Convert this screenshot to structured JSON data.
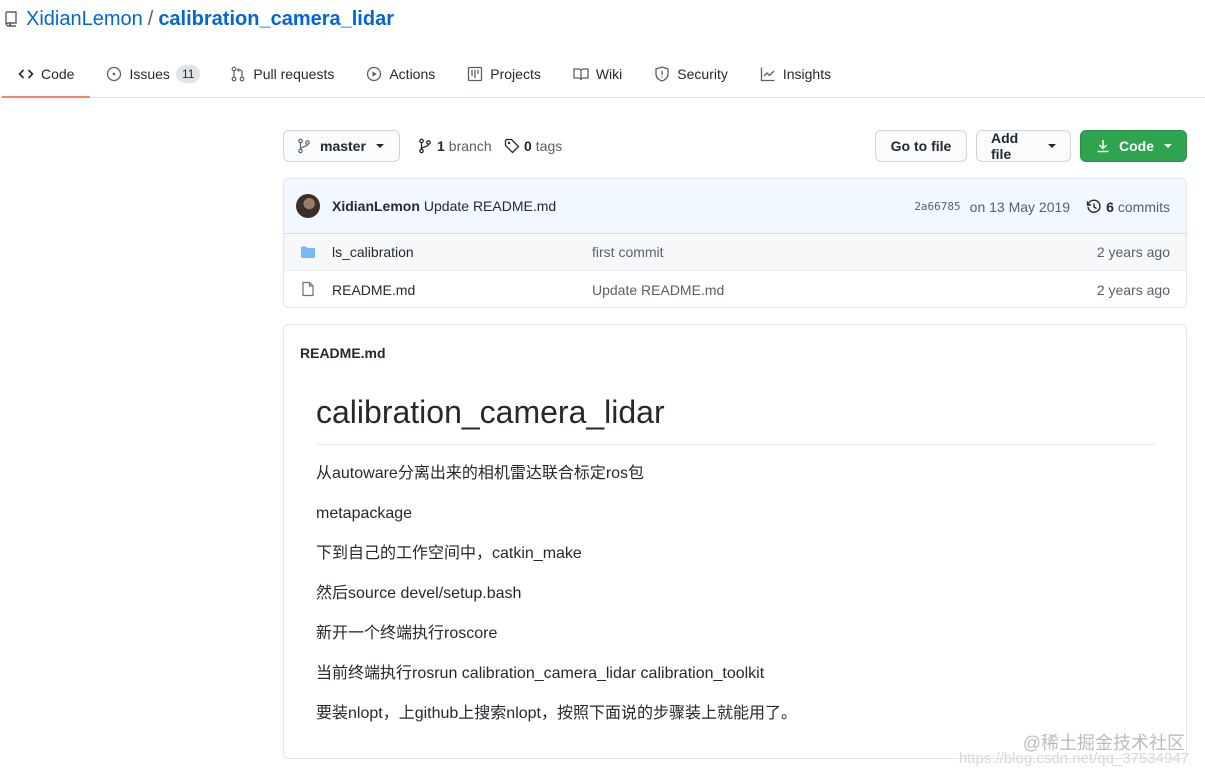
{
  "repo": {
    "owner": "XidianLemon",
    "separator": "/",
    "name": "calibration_camera_lidar"
  },
  "tabs": [
    {
      "label": "Code",
      "icon": "code-icon",
      "active": true
    },
    {
      "label": "Issues",
      "icon": "issue-opened-icon",
      "count": "11"
    },
    {
      "label": "Pull requests",
      "icon": "git-pull-request-icon"
    },
    {
      "label": "Actions",
      "icon": "play-icon"
    },
    {
      "label": "Projects",
      "icon": "project-icon"
    },
    {
      "label": "Wiki",
      "icon": "book-icon"
    },
    {
      "label": "Security",
      "icon": "shield-icon"
    },
    {
      "label": "Insights",
      "icon": "graph-icon"
    }
  ],
  "toolbar": {
    "branch_label": "master",
    "branch_count": "1",
    "branch_word": "branch",
    "tag_count": "0",
    "tag_word": "tags",
    "goto_file_label": "Go to file",
    "add_file_label": "Add file",
    "code_label": "Code"
  },
  "commit": {
    "author": "XidianLemon",
    "message": "Update README.md",
    "sha": "2a66785",
    "date": "on 13 May 2019",
    "commit_count": "6",
    "commit_word": "commits"
  },
  "files": [
    {
      "name": "ls_calibration",
      "type": "folder",
      "commit": "first commit",
      "age": "2 years ago"
    },
    {
      "name": "README.md",
      "type": "file",
      "commit": "Update README.md",
      "age": "2 years ago"
    }
  ],
  "readme": {
    "header": "README.md",
    "title": "calibration_camera_lidar",
    "paragraphs": [
      "从autoware分离出来的相机雷达联合标定ros包",
      "metapackage",
      "下到自己的工作空间中，catkin_make",
      "然后source devel/setup.bash",
      "新开一个终端执行roscore",
      "当前终端执行rosrun calibration_camera_lidar calibration_toolkit",
      "要装nlopt，上github上搜索nlopt，按照下面说的步骤装上就能用了。"
    ]
  },
  "watermark": {
    "text": "@稀土掘金技术社区",
    "faint_text": "https://blog.csdn.net/qq_37534947"
  },
  "colors": {
    "link": "#0366d6",
    "tab_underline": "#f9826c",
    "code_button": "#2ea44f",
    "commit_bar": "#f1f8ff",
    "folder_icon": "#79b8ff"
  }
}
